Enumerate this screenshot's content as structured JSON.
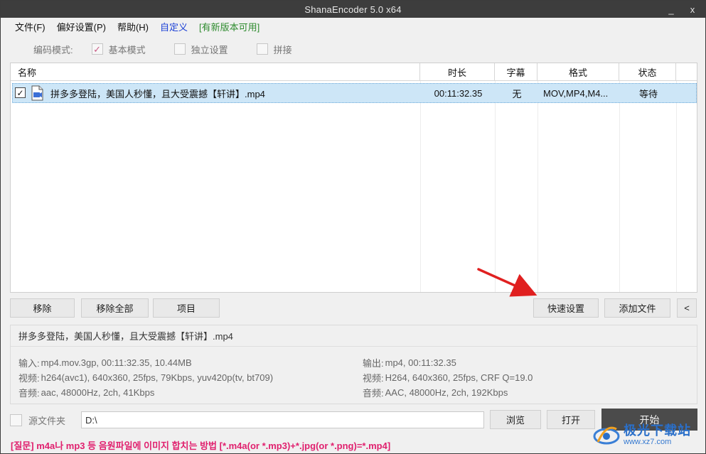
{
  "window": {
    "title": "ShanaEncoder 5.0 x64",
    "minimize_glyph": "_",
    "close_glyph": "x"
  },
  "menu": {
    "items": [
      {
        "label": "文件(F)"
      },
      {
        "label": "偏好设置(P)"
      },
      {
        "label": "帮助(H)"
      },
      {
        "label": "自定义"
      },
      {
        "label": "[有新版本可用]"
      }
    ]
  },
  "mode": {
    "label": "编码模式:",
    "options": [
      {
        "label": "基本模式",
        "checked": true
      },
      {
        "label": "独立设置",
        "checked": false
      },
      {
        "label": "拼接",
        "checked": false
      }
    ]
  },
  "file_list": {
    "columns": [
      "名称",
      "时长",
      "字幕",
      "格式",
      "状态"
    ],
    "rows": [
      {
        "checked": true,
        "name": "拼多多登陆，美国人秒懂，且大受震撼【轩讲】.mp4",
        "duration": "00:11:32.35",
        "subtitle": "无",
        "format": "MOV,MP4,M4...",
        "status": "等待"
      }
    ]
  },
  "buttons": {
    "remove": "移除",
    "remove_all": "移除全部",
    "item": "项目",
    "quick_settings": "快速设置",
    "add_file": "添加文件",
    "collapse": "<",
    "browse": "浏览",
    "open": "打开",
    "start": "开始"
  },
  "info": {
    "filename": "拼多多登陆，美国人秒懂，且大受震撼【轩讲】.mp4",
    "input": {
      "key": "输入:",
      "value": "mp4.mov.3gp, 00:11:32.35, 10.44MB"
    },
    "input_video": {
      "key": "视频:",
      "value": "h264(avc1), 640x360, 25fps, 79Kbps,  yuv420p(tv,  bt709)"
    },
    "input_audio": {
      "key": "音频:",
      "value": "aac, 48000Hz, 2ch, 41Kbps"
    },
    "output": {
      "key": "输出:",
      "value": "mp4, 00:11:32.35"
    },
    "output_video": {
      "key": "视频:",
      "value": "H264, 640x360, 25fps, CRF Q=19.0"
    },
    "output_audio": {
      "key": "音频:",
      "value": "AAC, 48000Hz, 2ch, 192Kbps"
    }
  },
  "source": {
    "label": "源文件夹",
    "checked": false,
    "path": "D:\\"
  },
  "footer": {
    "text": "[질문] m4a나 mp3 등 음원파일에 이미지 합치는 방법 [*.m4a(or *.mp3)+*.jpg(or *.png)=*.mp4]"
  },
  "watermark": {
    "main": "极光下载站",
    "sub": "www.xz7.com"
  },
  "colors": {
    "titlebar": "#3d3d3d",
    "selection": "#cde6f7",
    "footer_text": "#e0206e",
    "arrow": "#e02020",
    "start_button": "#4b4b4b"
  }
}
